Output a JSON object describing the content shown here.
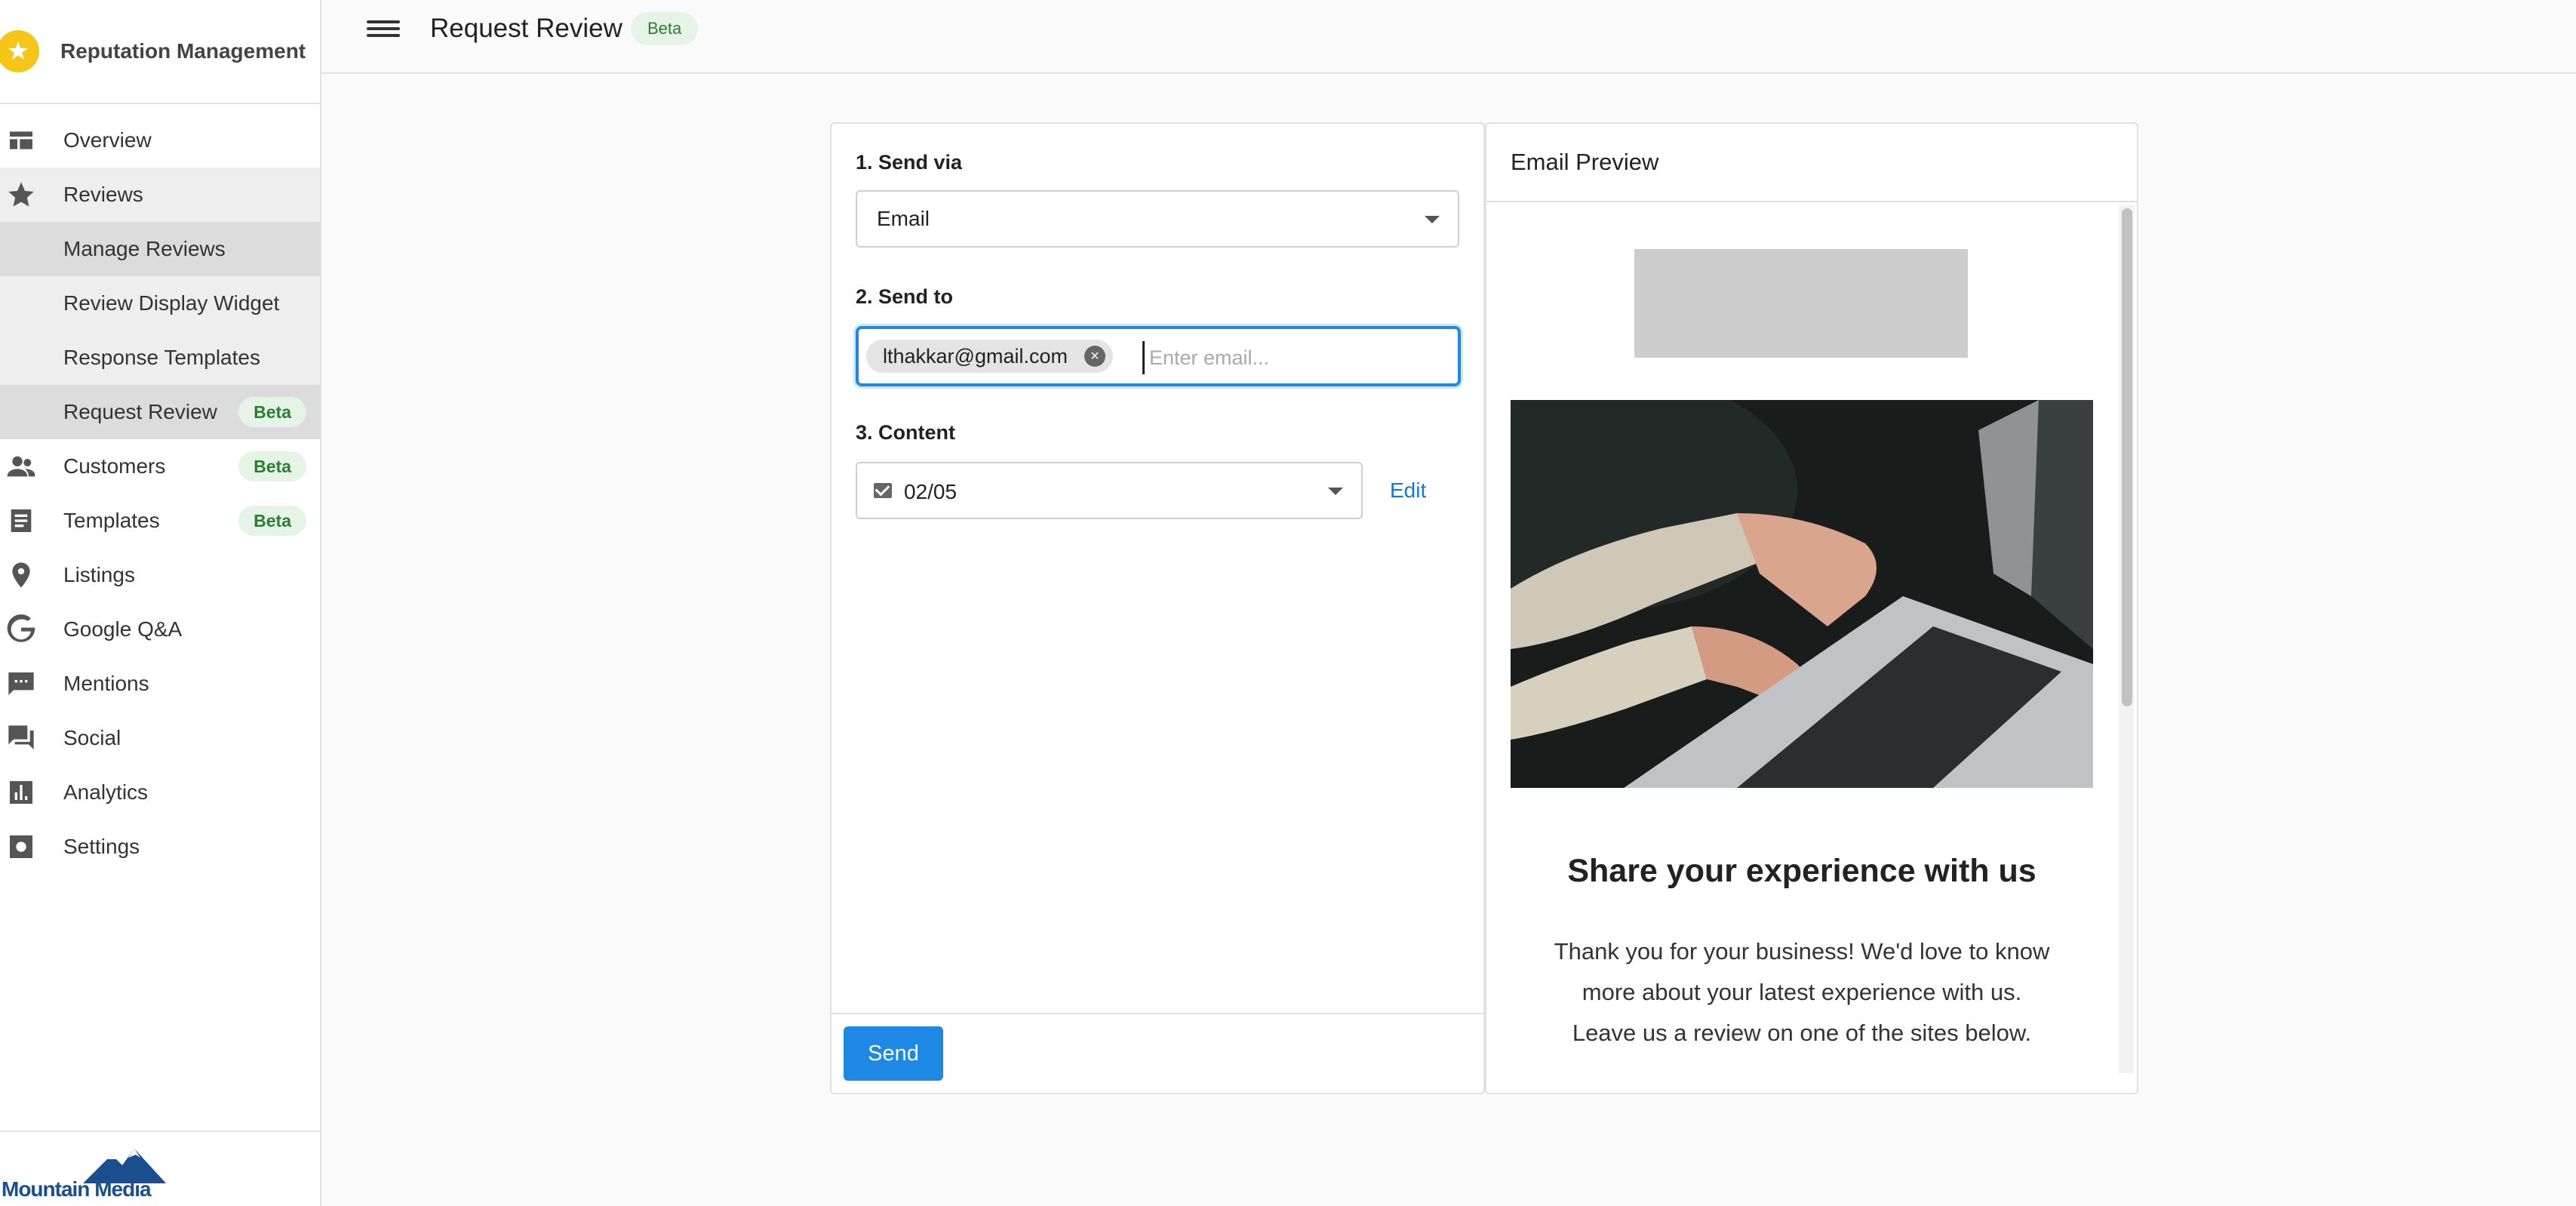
{
  "app": {
    "title": "Reputation Management"
  },
  "sidebar": {
    "items": [
      {
        "label": "Overview",
        "icon": "dashboard-icon"
      },
      {
        "label": "Reviews",
        "icon": "star-icon"
      },
      {
        "label": "Manage Reviews"
      },
      {
        "label": "Review Display Widget"
      },
      {
        "label": "Response Templates"
      },
      {
        "label": "Request Review",
        "badge": "Beta"
      },
      {
        "label": "Customers",
        "icon": "people-icon",
        "badge": "Beta"
      },
      {
        "label": "Templates",
        "icon": "document-icon",
        "badge": "Beta"
      },
      {
        "label": "Listings",
        "icon": "location-pin-icon"
      },
      {
        "label": "Google Q&A",
        "icon": "google-icon"
      },
      {
        "label": "Mentions",
        "icon": "chat-bubble-icon"
      },
      {
        "label": "Social",
        "icon": "forum-icon"
      },
      {
        "label": "Analytics",
        "icon": "bar-chart-icon"
      },
      {
        "label": "Settings",
        "icon": "settings-icon"
      }
    ],
    "footer_logo": "Mountain Media"
  },
  "header": {
    "title": "Request Review",
    "badge": "Beta"
  },
  "form": {
    "send_via_label": "1. Send via",
    "send_via_value": "Email",
    "send_to_label": "2. Send to",
    "recipient_chip": "lthakkar@gmail.com",
    "email_placeholder": "Enter email...",
    "content_label": "3. Content",
    "content_value": "02/05",
    "edit_label": "Edit",
    "send_label": "Send"
  },
  "preview": {
    "title": "Email Preview",
    "heading": "Share your experience with us",
    "body": "Thank you for your business! We'd love to know more about your latest experience with us. Leave us a review on one of the sites below."
  },
  "colors": {
    "accent": "#1e88e5",
    "badge_bg": "#e6f4e8",
    "badge_text": "#2e7d32",
    "brand_star": "#f5c518"
  }
}
